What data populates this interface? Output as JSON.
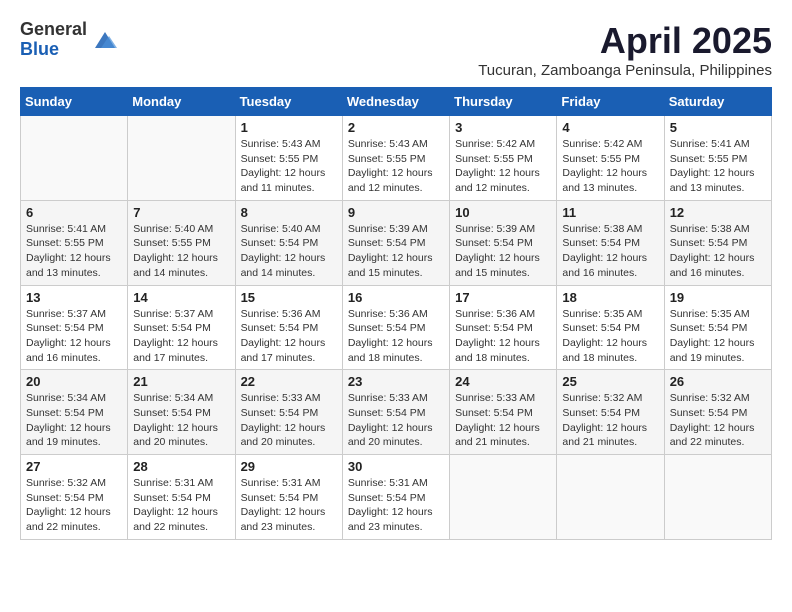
{
  "logo": {
    "general": "General",
    "blue": "Blue"
  },
  "title": {
    "month_year": "April 2025",
    "location": "Tucuran, Zamboanga Peninsula, Philippines"
  },
  "days_of_week": [
    "Sunday",
    "Monday",
    "Tuesday",
    "Wednesday",
    "Thursday",
    "Friday",
    "Saturday"
  ],
  "weeks": [
    [
      {
        "day": "",
        "content": ""
      },
      {
        "day": "",
        "content": ""
      },
      {
        "day": "1",
        "content": "Sunrise: 5:43 AM\nSunset: 5:55 PM\nDaylight: 12 hours\nand 11 minutes."
      },
      {
        "day": "2",
        "content": "Sunrise: 5:43 AM\nSunset: 5:55 PM\nDaylight: 12 hours\nand 12 minutes."
      },
      {
        "day": "3",
        "content": "Sunrise: 5:42 AM\nSunset: 5:55 PM\nDaylight: 12 hours\nand 12 minutes."
      },
      {
        "day": "4",
        "content": "Sunrise: 5:42 AM\nSunset: 5:55 PM\nDaylight: 12 hours\nand 13 minutes."
      },
      {
        "day": "5",
        "content": "Sunrise: 5:41 AM\nSunset: 5:55 PM\nDaylight: 12 hours\nand 13 minutes."
      }
    ],
    [
      {
        "day": "6",
        "content": "Sunrise: 5:41 AM\nSunset: 5:55 PM\nDaylight: 12 hours\nand 13 minutes."
      },
      {
        "day": "7",
        "content": "Sunrise: 5:40 AM\nSunset: 5:55 PM\nDaylight: 12 hours\nand 14 minutes."
      },
      {
        "day": "8",
        "content": "Sunrise: 5:40 AM\nSunset: 5:54 PM\nDaylight: 12 hours\nand 14 minutes."
      },
      {
        "day": "9",
        "content": "Sunrise: 5:39 AM\nSunset: 5:54 PM\nDaylight: 12 hours\nand 15 minutes."
      },
      {
        "day": "10",
        "content": "Sunrise: 5:39 AM\nSunset: 5:54 PM\nDaylight: 12 hours\nand 15 minutes."
      },
      {
        "day": "11",
        "content": "Sunrise: 5:38 AM\nSunset: 5:54 PM\nDaylight: 12 hours\nand 16 minutes."
      },
      {
        "day": "12",
        "content": "Sunrise: 5:38 AM\nSunset: 5:54 PM\nDaylight: 12 hours\nand 16 minutes."
      }
    ],
    [
      {
        "day": "13",
        "content": "Sunrise: 5:37 AM\nSunset: 5:54 PM\nDaylight: 12 hours\nand 16 minutes."
      },
      {
        "day": "14",
        "content": "Sunrise: 5:37 AM\nSunset: 5:54 PM\nDaylight: 12 hours\nand 17 minutes."
      },
      {
        "day": "15",
        "content": "Sunrise: 5:36 AM\nSunset: 5:54 PM\nDaylight: 12 hours\nand 17 minutes."
      },
      {
        "day": "16",
        "content": "Sunrise: 5:36 AM\nSunset: 5:54 PM\nDaylight: 12 hours\nand 18 minutes."
      },
      {
        "day": "17",
        "content": "Sunrise: 5:36 AM\nSunset: 5:54 PM\nDaylight: 12 hours\nand 18 minutes."
      },
      {
        "day": "18",
        "content": "Sunrise: 5:35 AM\nSunset: 5:54 PM\nDaylight: 12 hours\nand 18 minutes."
      },
      {
        "day": "19",
        "content": "Sunrise: 5:35 AM\nSunset: 5:54 PM\nDaylight: 12 hours\nand 19 minutes."
      }
    ],
    [
      {
        "day": "20",
        "content": "Sunrise: 5:34 AM\nSunset: 5:54 PM\nDaylight: 12 hours\nand 19 minutes."
      },
      {
        "day": "21",
        "content": "Sunrise: 5:34 AM\nSunset: 5:54 PM\nDaylight: 12 hours\nand 20 minutes."
      },
      {
        "day": "22",
        "content": "Sunrise: 5:33 AM\nSunset: 5:54 PM\nDaylight: 12 hours\nand 20 minutes."
      },
      {
        "day": "23",
        "content": "Sunrise: 5:33 AM\nSunset: 5:54 PM\nDaylight: 12 hours\nand 20 minutes."
      },
      {
        "day": "24",
        "content": "Sunrise: 5:33 AM\nSunset: 5:54 PM\nDaylight: 12 hours\nand 21 minutes."
      },
      {
        "day": "25",
        "content": "Sunrise: 5:32 AM\nSunset: 5:54 PM\nDaylight: 12 hours\nand 21 minutes."
      },
      {
        "day": "26",
        "content": "Sunrise: 5:32 AM\nSunset: 5:54 PM\nDaylight: 12 hours\nand 22 minutes."
      }
    ],
    [
      {
        "day": "27",
        "content": "Sunrise: 5:32 AM\nSunset: 5:54 PM\nDaylight: 12 hours\nand 22 minutes."
      },
      {
        "day": "28",
        "content": "Sunrise: 5:31 AM\nSunset: 5:54 PM\nDaylight: 12 hours\nand 22 minutes."
      },
      {
        "day": "29",
        "content": "Sunrise: 5:31 AM\nSunset: 5:54 PM\nDaylight: 12 hours\nand 23 minutes."
      },
      {
        "day": "30",
        "content": "Sunrise: 5:31 AM\nSunset: 5:54 PM\nDaylight: 12 hours\nand 23 minutes."
      },
      {
        "day": "",
        "content": ""
      },
      {
        "day": "",
        "content": ""
      },
      {
        "day": "",
        "content": ""
      }
    ]
  ]
}
